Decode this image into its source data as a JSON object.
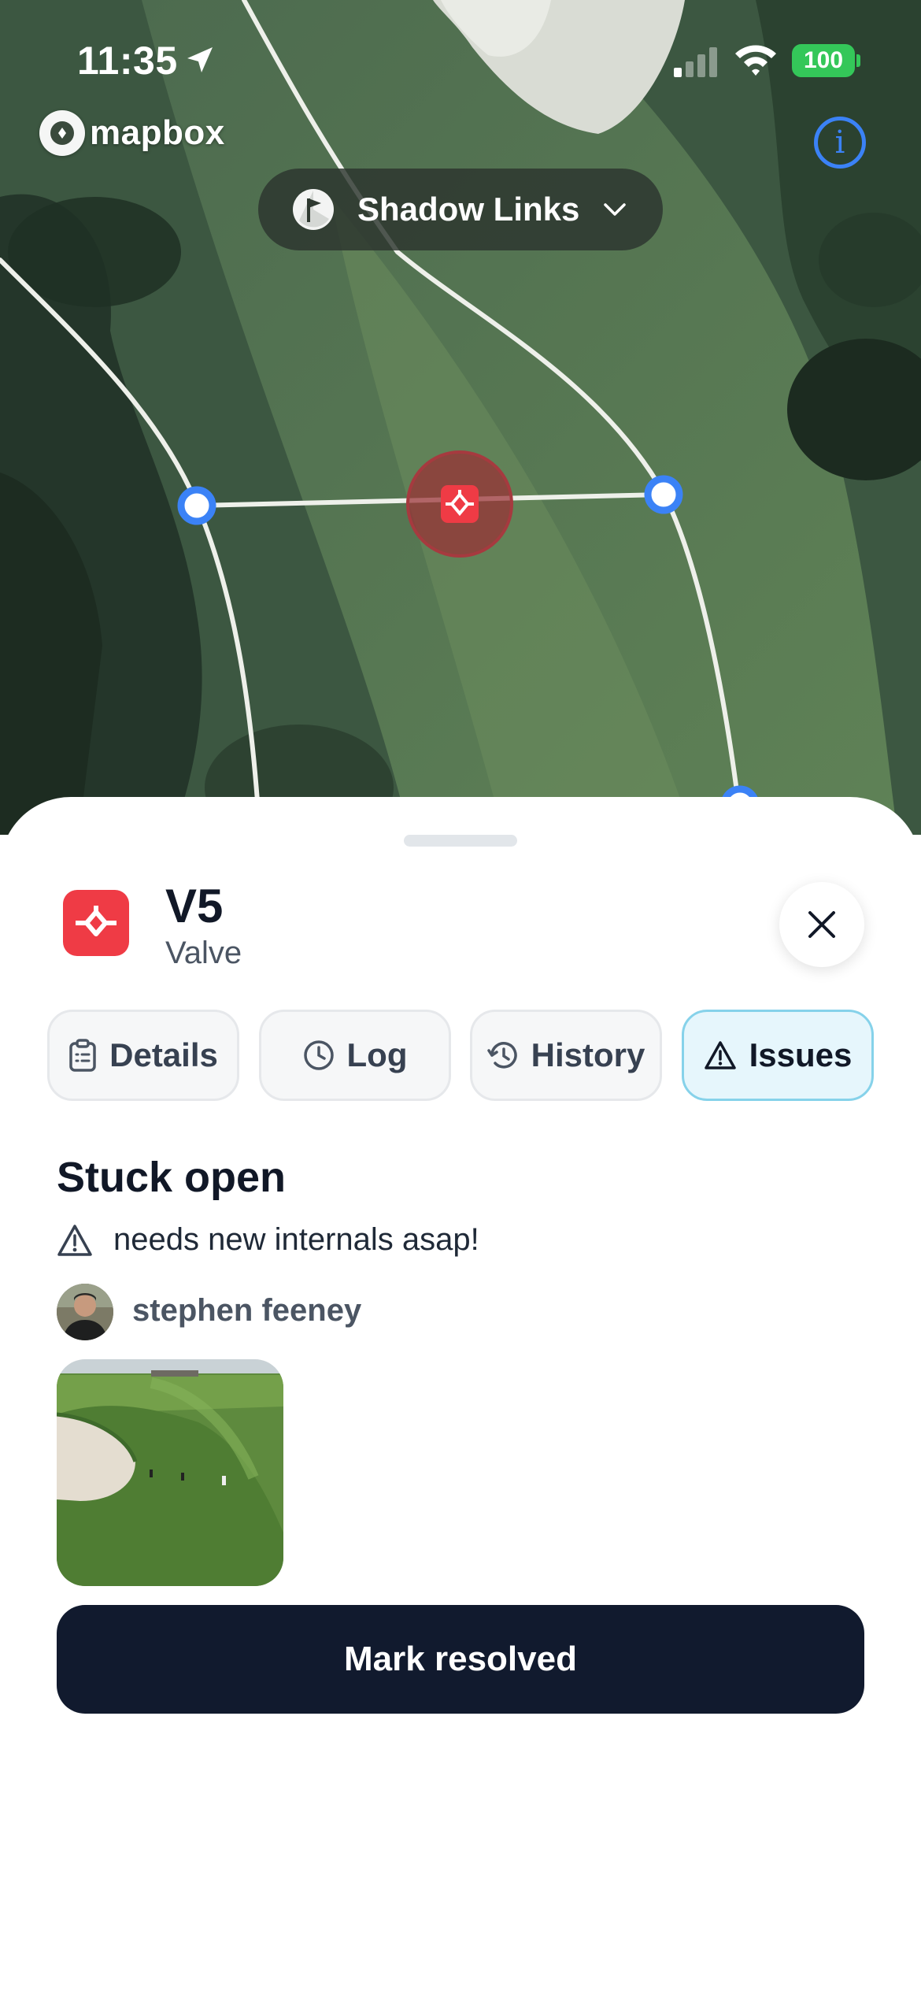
{
  "status_bar": {
    "time": "11:35",
    "battery": "100",
    "battery_color": "#34c759"
  },
  "map": {
    "attribution": "mapbox",
    "info_icon": "info-icon",
    "course_selector": {
      "label": "Shadow Links",
      "icon": "course-flag-icon"
    },
    "selected_marker_icon": "valve-icon",
    "line_color": "#eef0ea",
    "node_color": "#3b82f6"
  },
  "sheet": {
    "asset": {
      "title": "V5",
      "type": "Valve",
      "icon": "valve-icon",
      "icon_color": "#ef3b45"
    },
    "tabs": [
      {
        "label": "Details",
        "icon": "clipboard-icon",
        "active": false
      },
      {
        "label": "Log",
        "icon": "clock-icon",
        "active": false
      },
      {
        "label": "History",
        "icon": "history-icon",
        "active": false
      },
      {
        "label": "Issues",
        "icon": "warning-icon",
        "active": true
      }
    ],
    "issue": {
      "title": "Stuck open",
      "description": "needs new internals asap!",
      "reporter": "stephen feeney"
    },
    "primary_action": "Mark resolved",
    "accent_color": "#111a2e"
  }
}
